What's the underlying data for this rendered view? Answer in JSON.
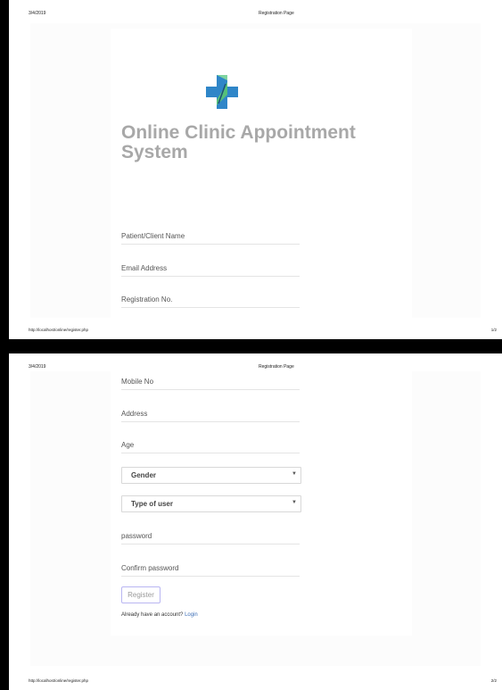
{
  "print_header": {
    "date": "3/4/2019",
    "title": "Registration Page"
  },
  "print_footer": {
    "url": "http://localhost/online/register.php",
    "page1": "1/2",
    "page2": "2/2"
  },
  "app": {
    "title_line1": "Online Clinic Appointment",
    "title_line2": "System",
    "logo_icon": "medical-cross-icon"
  },
  "form": {
    "patient_name": "Patient/Client Name",
    "email": "Email Address",
    "registration_no": "Registration No.",
    "mobile": "Mobile No",
    "address": "Address",
    "age": "Age",
    "gender": "Gender",
    "user_type": "Type of user",
    "password": "password",
    "confirm_password": "Confirm password",
    "register_button": "Register",
    "already_text": "Already have an account?",
    "login_link": "Login"
  },
  "colors": {
    "title": "#a8a8a8",
    "link": "#3d6fb6",
    "button_border": "#b9b6f2",
    "logo_blue": "#2f86c8",
    "logo_green": "#55c07a"
  }
}
